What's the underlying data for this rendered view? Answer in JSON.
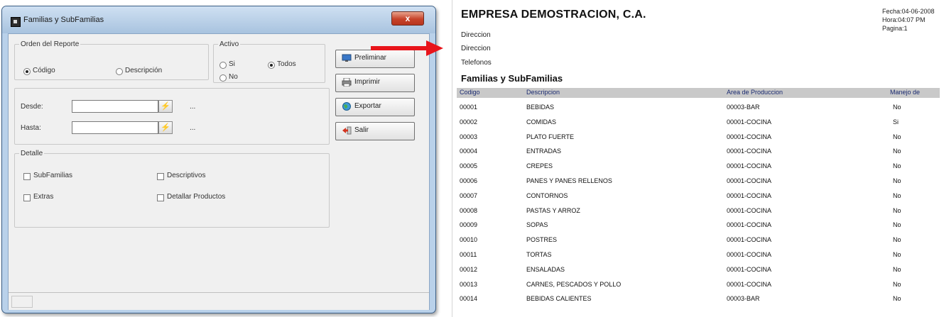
{
  "dialog": {
    "title": "Familias y SubFamilias",
    "close_label": "x",
    "orden": {
      "legend": "Orden del Reporte",
      "options": [
        {
          "label": "Código",
          "selected": true
        },
        {
          "label": "Descripción",
          "selected": false
        }
      ]
    },
    "activo": {
      "legend": "Activo",
      "options": [
        {
          "label": "Si",
          "selected": false
        },
        {
          "label": "Todos",
          "selected": true
        },
        {
          "label": "No",
          "selected": false
        }
      ]
    },
    "rango": {
      "desde_label": "Desde:",
      "hasta_label": "Hasta:",
      "desde_value": "",
      "hasta_value": "",
      "pick_glyph": "⚡",
      "ellipsis": "..."
    },
    "detalle": {
      "legend": "Detalle",
      "items": [
        {
          "label": "SubFamilias",
          "checked": false
        },
        {
          "label": "Descriptivos",
          "checked": false
        },
        {
          "label": "Extras",
          "checked": false
        },
        {
          "label": "Detallar Productos",
          "checked": false
        }
      ]
    },
    "buttons": [
      {
        "label": "Preliminar",
        "icon": "monitor-icon"
      },
      {
        "label": "Imprimir",
        "icon": "printer-icon"
      },
      {
        "label": "Exportar",
        "icon": "globe-icon"
      },
      {
        "label": "Salir",
        "icon": "exit-arrow-icon"
      }
    ]
  },
  "arrow_color": "#e8141a",
  "report": {
    "company": "EMPRESA DEMOSTRACION, C.A.",
    "address_lines": [
      "Direccion",
      "Direccion",
      "Telefonos"
    ],
    "meta": [
      "Fecha:04-06-2008",
      "Hora:04:07 PM",
      "Pagina:1"
    ],
    "title": "Familias y SubFamilias",
    "columns": [
      "Codigo",
      "Descripcion",
      "Area de Produccion",
      "Manejo de"
    ],
    "rows": [
      [
        "00001",
        "BEBIDAS",
        "00003-BAR",
        "No"
      ],
      [
        "00002",
        "COMIDAS",
        "00001-COCINA",
        "Si"
      ],
      [
        "00003",
        "PLATO FUERTE",
        "00001-COCINA",
        "No"
      ],
      [
        "00004",
        "ENTRADAS",
        "00001-COCINA",
        "No"
      ],
      [
        "00005",
        "CREPES",
        "00001-COCINA",
        "No"
      ],
      [
        "00006",
        "PANES Y PANES RELLENOS",
        "00001-COCINA",
        "No"
      ],
      [
        "00007",
        "CONTORNOS",
        "00001-COCINA",
        "No"
      ],
      [
        "00008",
        "PASTAS Y ARROZ",
        "00001-COCINA",
        "No"
      ],
      [
        "00009",
        "SOPAS",
        "00001-COCINA",
        "No"
      ],
      [
        "00010",
        "POSTRES",
        "00001-COCINA",
        "No"
      ],
      [
        "00011",
        "TORTAS",
        "00001-COCINA",
        "No"
      ],
      [
        "00012",
        "ENSALADAS",
        "00001-COCINA",
        "No"
      ],
      [
        "00013",
        "CARNES, PESCADOS Y POLLO",
        "00001-COCINA",
        "No"
      ],
      [
        "00014",
        "BEBIDAS CALIENTES",
        "00003-BAR",
        "No"
      ]
    ]
  }
}
